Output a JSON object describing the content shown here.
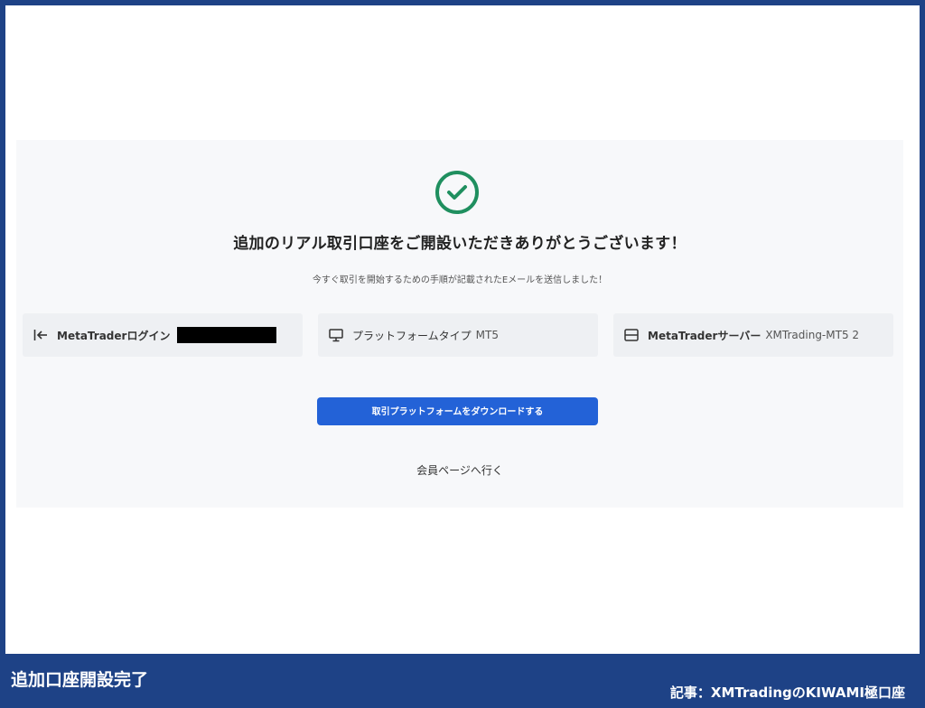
{
  "success": {
    "title": "追加のリアル取引口座をご開設いただきありがとうございます！",
    "subtitle": "今すぐ取引を開始するための手順が記載されたEメールを送信しました！"
  },
  "info": {
    "login": {
      "icon": "login-arrow-icon",
      "label": "MetaTraderログイン",
      "value": ""
    },
    "platform": {
      "icon": "monitor-icon",
      "label": "プラットフォームタイプ",
      "value": "MT5"
    },
    "server": {
      "icon": "server-icon",
      "label": "MetaTraderサーバー",
      "value": "XMTrading-MT5 2"
    }
  },
  "actions": {
    "download_label": "取引プラットフォームをダウンロードする",
    "member_link": "会員ページへ行く"
  },
  "captions": {
    "left": "追加口座開設完了",
    "right": "記事：XMTradingのKIWAMI極口座"
  },
  "colors": {
    "accent": "#2362d7",
    "success": "#1f8f5f",
    "frame": "#1e4286"
  }
}
